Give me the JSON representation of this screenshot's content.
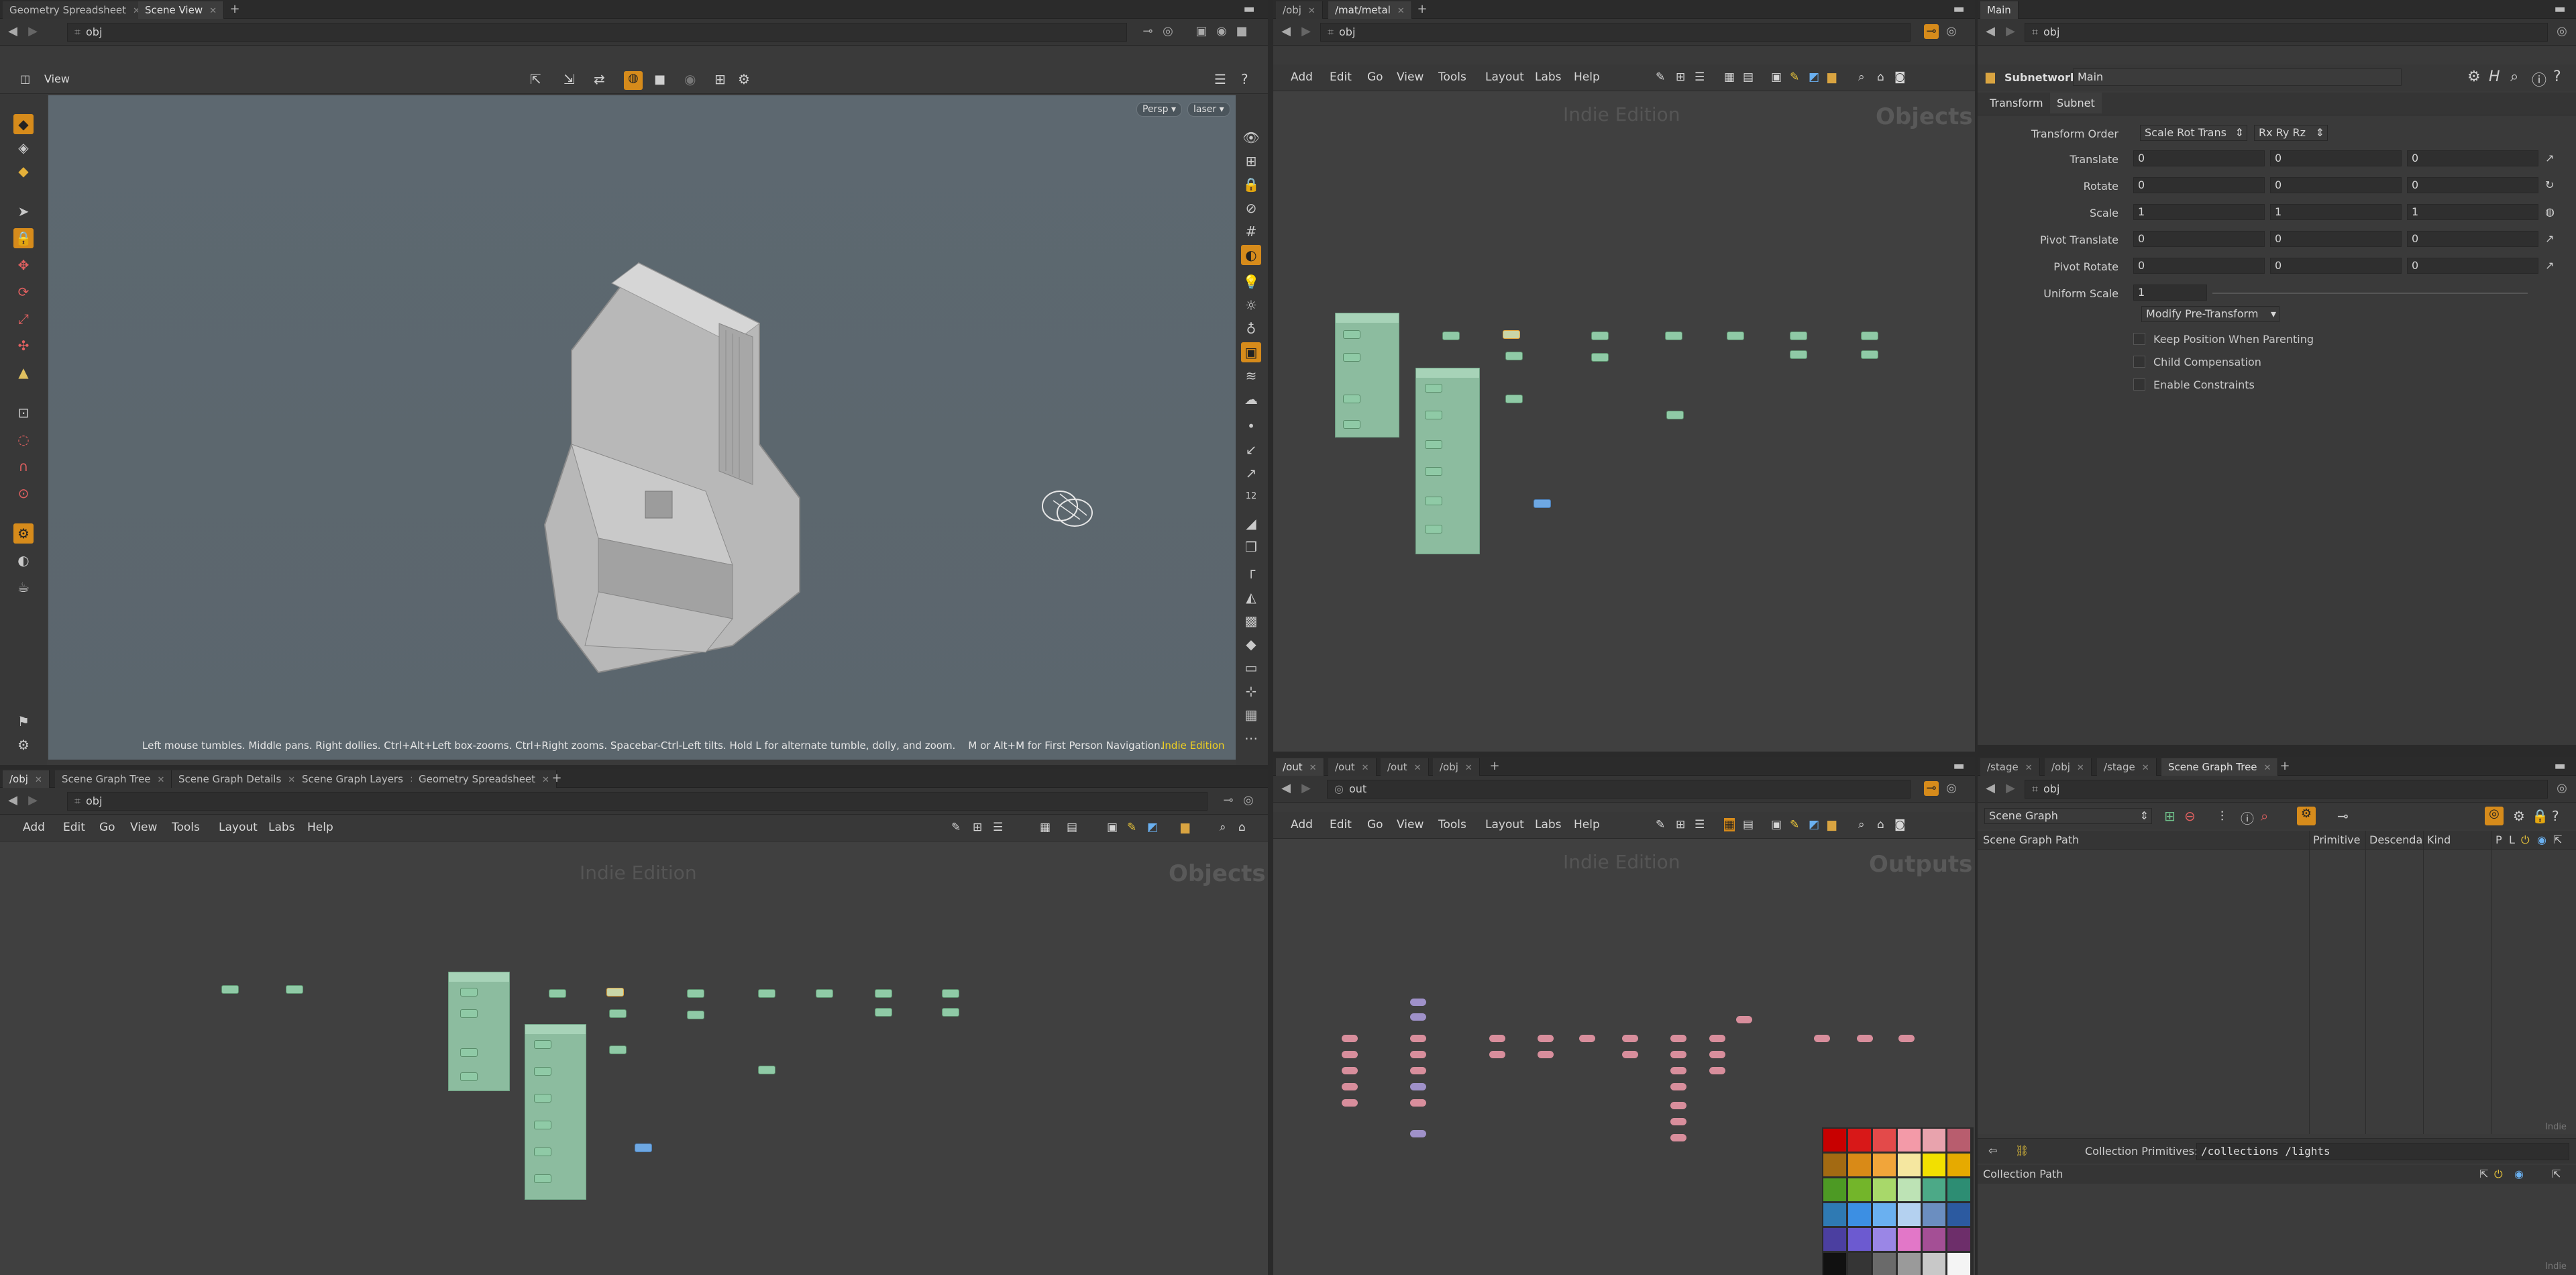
{
  "viewport_pane": {
    "tabs": [
      {
        "label": "Geometry Spreadsheet"
      },
      {
        "label": "Scene View"
      }
    ],
    "path": "obj",
    "view_label": "View",
    "persp": "Persp",
    "cam": "laser",
    "hint": "Left mouse tumbles. Middle pans. Right dollies. Ctrl+Alt+Left box-zooms. Ctrl+Right zooms. Spacebar-Ctrl-Left tilts. Hold L for alternate tumble, dolly, and zoom.    M or Alt+M for First Person Navigation.",
    "edition": "Indie Edition"
  },
  "network_top": {
    "tabs": [
      {
        "label": "/obj"
      },
      {
        "label": "/mat/metal"
      }
    ],
    "path": "obj",
    "menus": [
      "Add",
      "Edit",
      "Go",
      "View",
      "Tools",
      "Layout",
      "Labs",
      "Help"
    ],
    "watermark": "Indie Edition",
    "context": "Objects"
  },
  "parms": {
    "tab_label": "Main",
    "path": "obj",
    "node_type": "Subnetwork",
    "node_name": "Main",
    "subtabs": [
      "Transform",
      "Subnet"
    ],
    "transform_order_label": "Transform Order",
    "transform_order": "Scale Rot Trans",
    "rot_order": "Rx Ry Rz",
    "rows": [
      {
        "label": "Translate",
        "v": [
          "0",
          "0",
          "0"
        ]
      },
      {
        "label": "Rotate",
        "v": [
          "0",
          "0",
          "0"
        ]
      },
      {
        "label": "Scale",
        "v": [
          "1",
          "1",
          "1"
        ]
      },
      {
        "label": "Pivot Translate",
        "v": [
          "0",
          "0",
          "0"
        ]
      },
      {
        "label": "Pivot Rotate",
        "v": [
          "0",
          "0",
          "0"
        ]
      }
    ],
    "uniform_scale_label": "Uniform Scale",
    "uniform_scale": "1",
    "pretransform": "Modify Pre-Transform",
    "checks": [
      "Keep Position When Parenting",
      "Child Compensation",
      "Enable Constraints"
    ]
  },
  "network_bottom_left": {
    "tabs": [
      {
        "label": "/obj"
      },
      {
        "label": "Scene Graph Tree"
      },
      {
        "label": "Scene Graph Details"
      },
      {
        "label": "Scene Graph Layers"
      },
      {
        "label": "Geometry Spreadsheet"
      }
    ],
    "path": "obj",
    "menus": [
      "Add",
      "Edit",
      "Go",
      "View",
      "Tools",
      "Layout",
      "Labs",
      "Help"
    ],
    "watermark": "Indie Edition",
    "context": "Objects"
  },
  "network_out": {
    "tabs": [
      {
        "label": "/out"
      },
      {
        "label": "/out"
      },
      {
        "label": "/out"
      },
      {
        "label": "/obj"
      }
    ],
    "path": "out",
    "menus": [
      "Add",
      "Edit",
      "Go",
      "View",
      "Tools",
      "Layout",
      "Labs",
      "Help"
    ],
    "watermark": "Indie Edition",
    "context": "Outputs"
  },
  "scene_graph": {
    "tabs": [
      {
        "label": "/stage"
      },
      {
        "label": "/obj"
      },
      {
        "label": "/stage"
      },
      {
        "label": "Scene Graph Tree"
      }
    ],
    "path": "obj",
    "mode": "Scene Graph",
    "columns": [
      "Scene Graph Path",
      "Primitive",
      "Descenda",
      "Kind",
      "P",
      "L"
    ],
    "corner": "Indie",
    "collection_label": "Collection Primitives:",
    "collection_value": "/collections /lights",
    "collection_col": "Collection Path",
    "corner2": "Indie"
  },
  "palette": [
    "#c80000",
    "#d81818",
    "#e34a4a",
    "#f39aa8",
    "#e8a3ad",
    "#b85d6e",
    "#a36a12",
    "#d98a17",
    "#f1a53a",
    "#f5e7a0",
    "#f2e000",
    "#e6aa00",
    "#4d9a24",
    "#73b52a",
    "#a8d86a",
    "#bde3b5",
    "#4ca987",
    "#2d8d73",
    "#2f7ab3",
    "#3c8fe3",
    "#6ab0f0",
    "#b4d1f0",
    "#6b8ec0",
    "#2c5aa0",
    "#4b3fa0",
    "#6c5ad0",
    "#9a86e6",
    "#e277c8",
    "#a44f95",
    "#6d2e6a",
    "#111111",
    "#353535",
    "#6a6a6a",
    "#9a9a9a",
    "#c8c8c8",
    "#f4f4f4"
  ]
}
